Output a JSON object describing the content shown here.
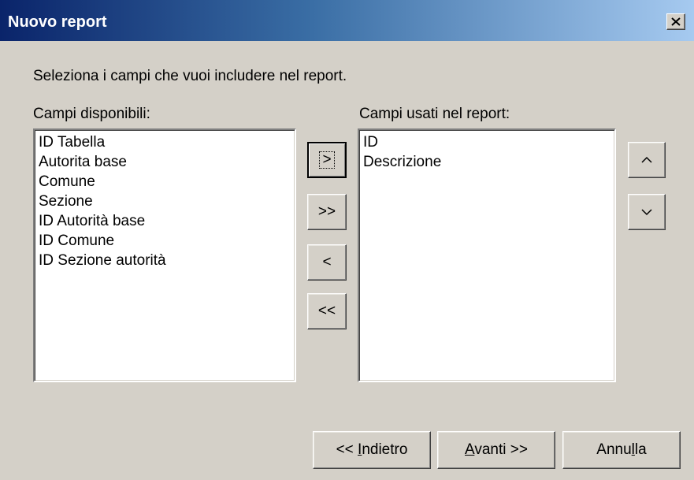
{
  "window": {
    "title": "Nuovo report"
  },
  "instructions": "Seleziona i campi che vuoi includere nel report.",
  "available": {
    "label": "Campi disponibili:",
    "items": [
      "ID Tabella",
      "Autorita base",
      "Comune",
      "Sezione",
      "ID Autorità base",
      "ID Comune",
      "ID Sezione autorità"
    ]
  },
  "used": {
    "label": "Campi usati nel report:",
    "items": [
      "ID",
      "Descrizione"
    ]
  },
  "transfer": {
    "add_one": ">",
    "add_all": ">>",
    "remove_one": "<",
    "remove_all": "<<"
  },
  "order": {
    "up_icon": "chevron-up-icon",
    "down_icon": "chevron-down-icon"
  },
  "nav": {
    "back": {
      "prefix": "<< ",
      "mnemonic": "I",
      "rest": "ndietro"
    },
    "next": {
      "prefix": "",
      "mnemonic": "A",
      "rest": "vanti >>"
    },
    "cancel": {
      "before": "Annu",
      "mnemonic": "l",
      "rest": "la"
    }
  }
}
